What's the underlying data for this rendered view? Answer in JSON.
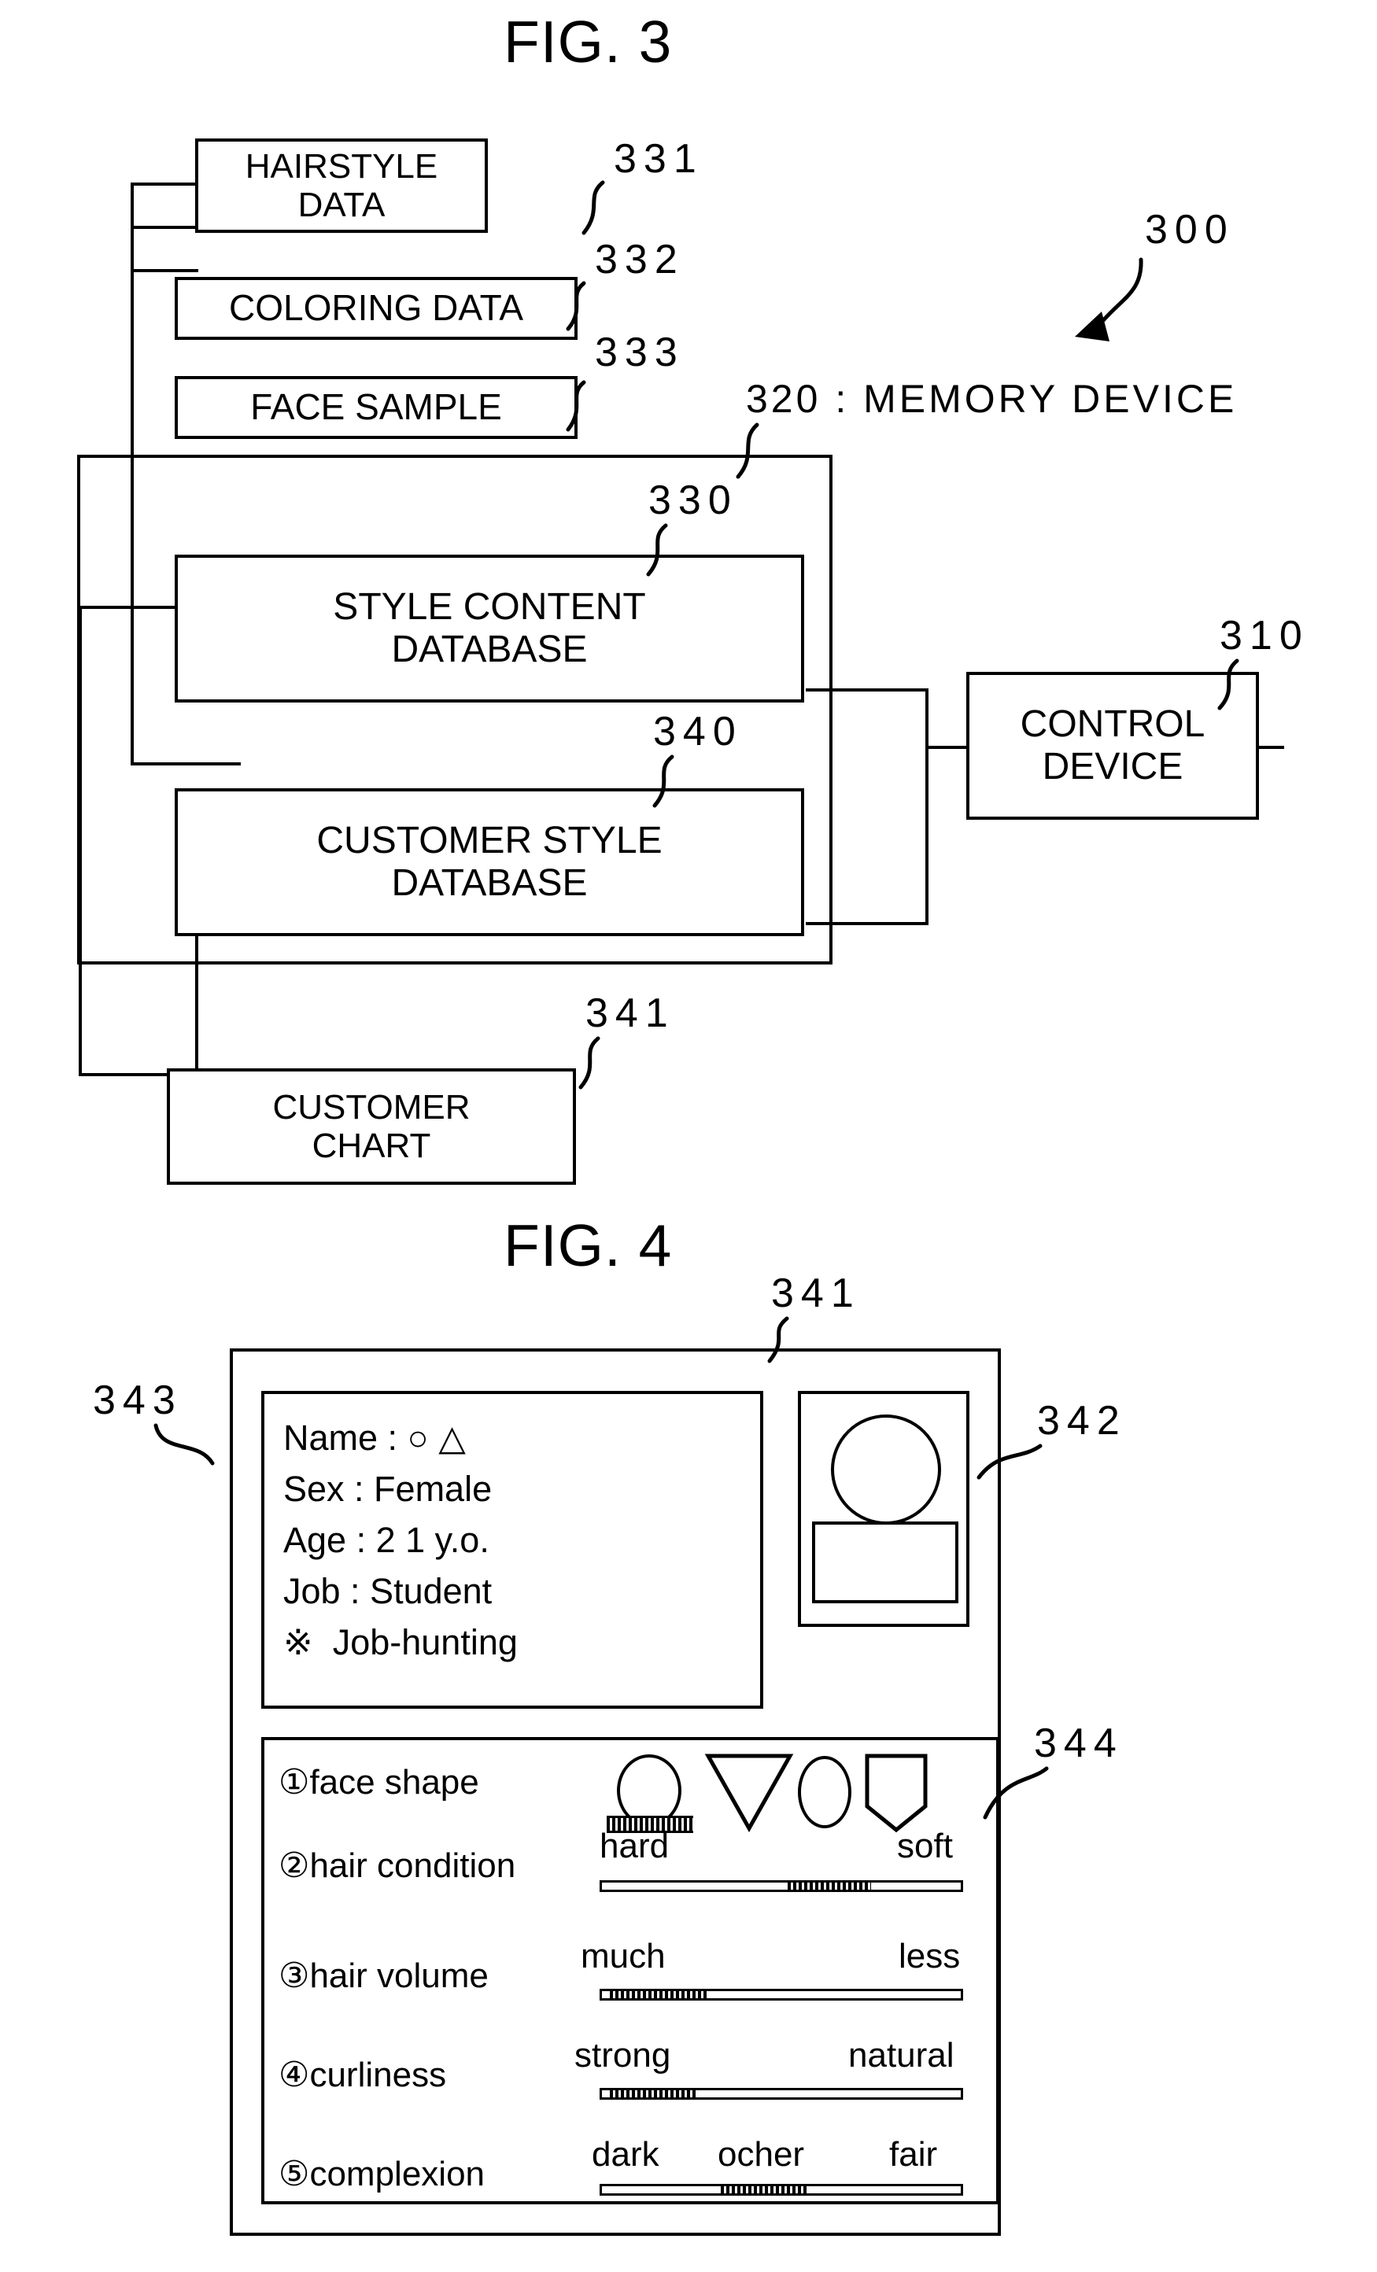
{
  "figures": [
    {
      "title": "FIG. 3",
      "system_ref": "300",
      "nodes": {
        "hairstyle_data": {
          "label": "HAIRSTYLE\nDATA",
          "ref": "331"
        },
        "coloring_data": {
          "label": "COLORING DATA",
          "ref": "332"
        },
        "face_sample": {
          "label": "FACE SAMPLE",
          "ref": "333"
        },
        "memory_device": {
          "label": "320 : MEMORY DEVICE",
          "ref": "320"
        },
        "style_content_db": {
          "label": "STYLE CONTENT\nDATABASE",
          "ref": "330"
        },
        "customer_style_db": {
          "label": "CUSTOMER STYLE\nDATABASE",
          "ref": "340"
        },
        "customer_chart": {
          "label": "CUSTOMER\nCHART",
          "ref": "341"
        },
        "control_device": {
          "label": "CONTROL\nDEVICE",
          "ref": "310"
        }
      }
    },
    {
      "title": "FIG. 4",
      "chart_ref": "341",
      "profile_panel_ref": "343",
      "photo_panel_ref": "342",
      "attributes_panel_ref": "344",
      "profile": {
        "lines": [
          "Name : ○ △",
          "Sex : Female",
          "Age : 2 1 y.o.",
          "Job : Student",
          "※  Job-hunting"
        ]
      },
      "attributes": [
        {
          "index": "①",
          "name": "face shape",
          "type": "shape-choice",
          "options": [
            "round",
            "inverted-triangle",
            "oval",
            "square-pointed"
          ],
          "selected": 0
        },
        {
          "index": "②",
          "name": "hair condition",
          "type": "slider",
          "left_label": "hard",
          "right_label": "soft",
          "value_pct": 72
        },
        {
          "index": "③",
          "name": "hair volume",
          "type": "slider",
          "left_label": "much",
          "right_label": "less",
          "value_pct": 13
        },
        {
          "index": "④",
          "name": "curliness",
          "type": "slider",
          "left_label": "strong",
          "right_label": "natural",
          "value_pct": 12
        },
        {
          "index": "⑤",
          "name": "complexion",
          "type": "slider",
          "left_label": "dark",
          "mid_label": "ocher",
          "right_label": "fair",
          "value_pct": 46
        }
      ]
    }
  ],
  "colors": {
    "ink": "#000000",
    "paper": "#ffffff"
  }
}
